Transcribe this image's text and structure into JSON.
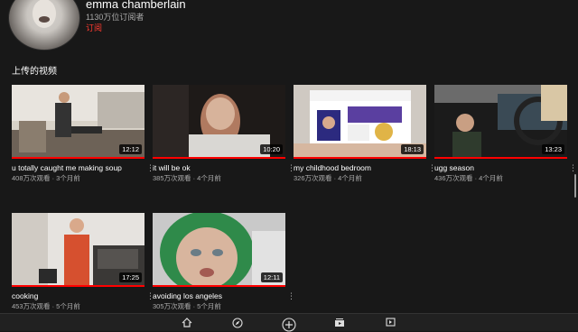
{
  "channel": {
    "name": "emma chamberlain",
    "subscribers": "1130万位订阅者",
    "subscribe_label": "订阅"
  },
  "section": {
    "title": "上传的视频"
  },
  "videos": [
    {
      "title": "u totally caught me making soup",
      "meta": "408万次观看 · 3个月前",
      "duration": "12:12"
    },
    {
      "title": "it will be ok",
      "meta": "385万次观看 · 4个月前",
      "duration": "10:20"
    },
    {
      "title": "my childhood bedroom",
      "meta": "326万次观看 · 4个月前",
      "duration": "18:13"
    },
    {
      "title": "ugg season",
      "meta": "436万次观看 · 4个月前",
      "duration": "13:23"
    },
    {
      "title": "cooking",
      "meta": "453万次观看 · 5个月前",
      "duration": "17:25"
    },
    {
      "title": "avoiding los angeles",
      "meta": "305万次观看 · 5个月前",
      "duration": "12:11"
    }
  ],
  "tabbar": {
    "items": [
      {
        "icon": "home-icon"
      },
      {
        "icon": "explore-icon"
      },
      {
        "icon": "create-icon"
      },
      {
        "icon": "subscriptions-icon"
      },
      {
        "icon": "library-icon"
      }
    ]
  }
}
